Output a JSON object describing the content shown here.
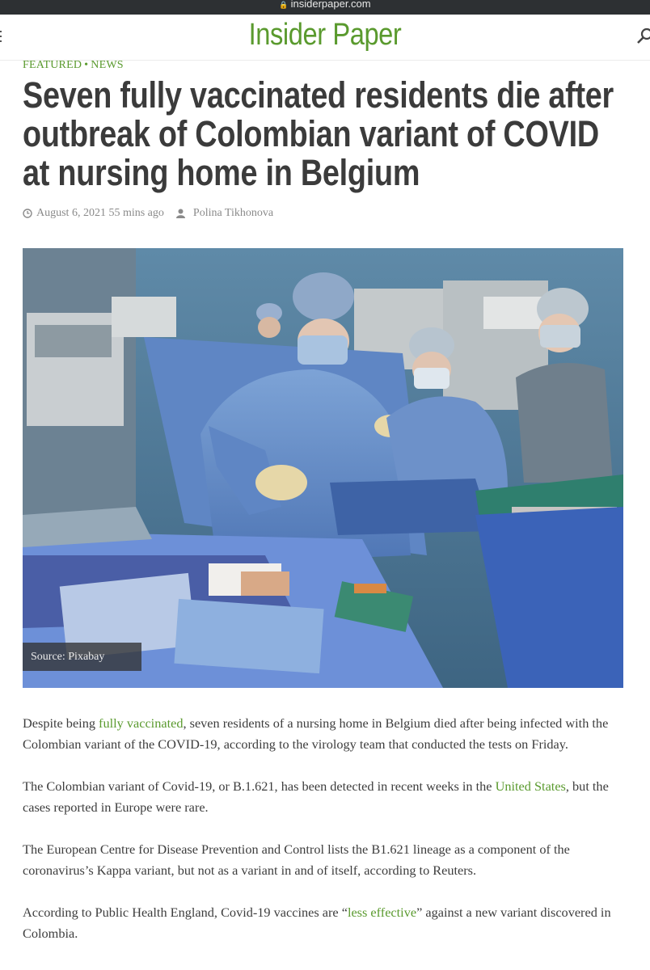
{
  "browser": {
    "url": "insiderpaper.com"
  },
  "site": {
    "name": "Insider Paper"
  },
  "post": {
    "categories": [
      "FEATURED",
      "NEWS"
    ],
    "separator": "•",
    "title": "Seven fully vaccinated residents die after outbreak of Colombian variant of COVID at nursing home in Belgium",
    "date": "August 6, 2021",
    "ago": "55 mins ago",
    "author": "Polina Tikhonova"
  },
  "image": {
    "caption": "Source: Pixabay"
  },
  "article": {
    "p1": {
      "before": "Despite being ",
      "link": "fully vaccinated",
      "after": ", seven residents of a nursing home in Belgium died after being infected with the Colombian variant of the COVID-19, according to the virology team that conducted the tests on Friday."
    },
    "p2": {
      "before": "The Colombian variant of Covid-19, or B.1.621, has been detected in recent weeks in the ",
      "link": "United States",
      "after": ", but the cases reported in Europe were rare."
    },
    "p3": {
      "text": "The European Centre for Disease Prevention and Control lists the B1.621 lineage as a component of the coronavirus’s Kappa variant, but not as a variant in and of itself, according to Reuters."
    },
    "p4": {
      "before": "According to Public Health England, Covid-19 vaccines are “",
      "link": "less effective",
      "after": "” against a new variant discovered in Colombia."
    }
  },
  "colors": {
    "brand": "#5a9a2e",
    "text": "#3b3b3b",
    "meta": "#8a8a8a"
  },
  "icons": [
    "lock-icon",
    "menu-icon",
    "search-icon",
    "clock-icon",
    "user-icon"
  ]
}
